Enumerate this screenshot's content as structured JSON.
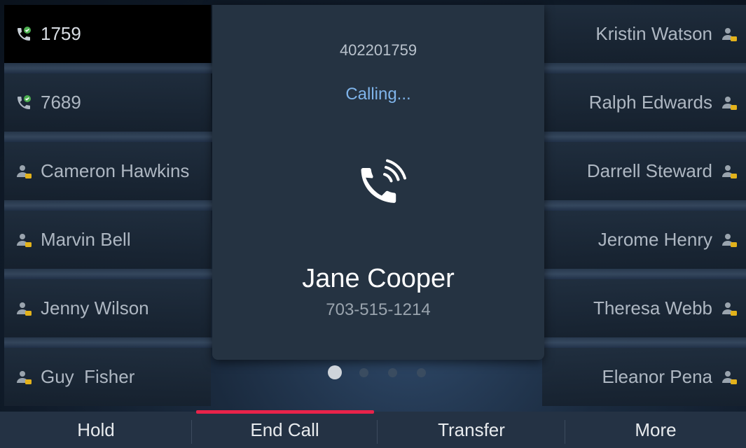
{
  "colors": {
    "popup_bg": "#253342",
    "calling_text": "#7fb4ea",
    "active_indicator": "#e8234a",
    "presence_badge": "#e3b21b",
    "call_active_badge": "#4caf50",
    "softkey_bar": "#243244"
  },
  "left_lines": [
    {
      "label": "1759",
      "icon": "phone-active-icon",
      "active": true
    },
    {
      "label": "7689",
      "icon": "phone-active-icon",
      "active": false
    },
    {
      "label": "Cameron Hawkins",
      "icon": "contact-presence-icon",
      "active": false
    },
    {
      "label": "Marvin Bell",
      "icon": "contact-presence-icon",
      "active": false
    },
    {
      "label": "Jenny Wilson",
      "icon": "contact-presence-icon",
      "active": false
    },
    {
      "label": "Guy  Fisher",
      "icon": "contact-presence-icon",
      "active": false
    }
  ],
  "right_lines": [
    {
      "label": "Kristin Watson",
      "icon": "contact-presence-icon"
    },
    {
      "label": "Ralph Edwards",
      "icon": "contact-presence-icon"
    },
    {
      "label": "Darrell Steward",
      "icon": "contact-presence-icon"
    },
    {
      "label": "Jerome Henry",
      "icon": "contact-presence-icon"
    },
    {
      "label": "Theresa Webb",
      "icon": "contact-presence-icon"
    },
    {
      "label": "Eleanor Pena",
      "icon": "contact-presence-icon"
    }
  ],
  "call": {
    "dialed_number": "402201759",
    "status": "Calling...",
    "icon": "phone-ringing-icon",
    "contact_name": "Jane Cooper",
    "contact_number": "703-515-1214"
  },
  "pagination": {
    "total_pages": 4,
    "current_page": 1
  },
  "softkeys": [
    {
      "label": "Hold"
    },
    {
      "label": "End Call",
      "active": true
    },
    {
      "label": "Transfer"
    },
    {
      "label": "More"
    }
  ]
}
